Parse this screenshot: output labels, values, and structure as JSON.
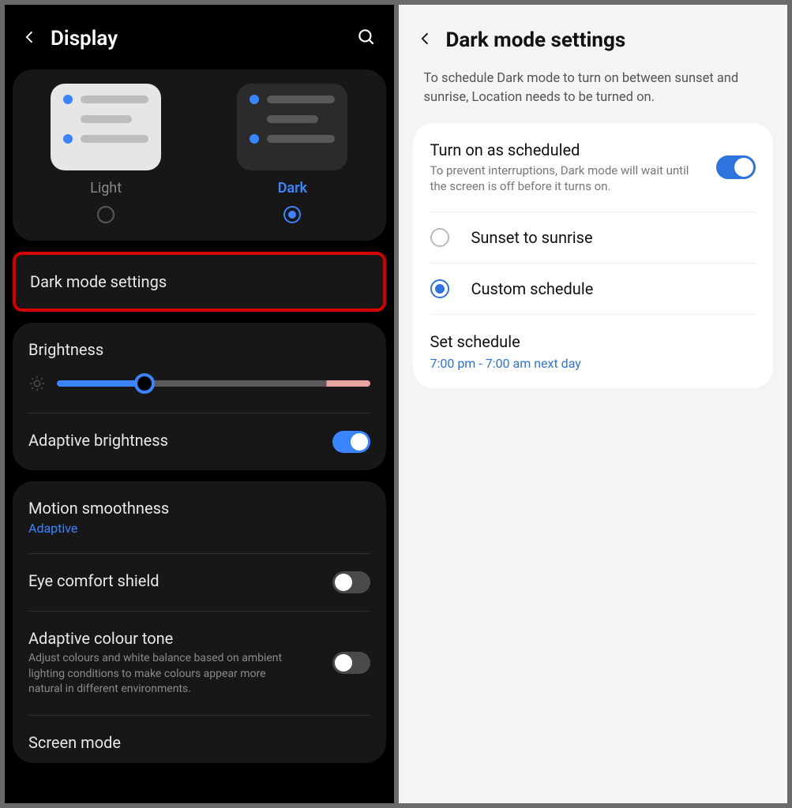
{
  "left": {
    "title": "Display",
    "theme": {
      "light_label": "Light",
      "dark_label": "Dark",
      "selected": "dark"
    },
    "dark_mode_settings_label": "Dark mode settings",
    "brightness_label": "Brightness",
    "adaptive_brightness": {
      "label": "Adaptive brightness",
      "on": true
    },
    "motion_smoothness": {
      "label": "Motion smoothness",
      "value": "Adaptive"
    },
    "eye_comfort": {
      "label": "Eye comfort shield",
      "on": false
    },
    "adaptive_colour_tone": {
      "label": "Adaptive colour tone",
      "desc": "Adjust colours and white balance based on ambient lighting conditions to make colours appear more natural in different environments.",
      "on": false
    },
    "screen_mode_label": "Screen mode"
  },
  "right": {
    "title": "Dark mode settings",
    "note": "To schedule Dark mode to turn on between sunset and sunrise, Location needs to be turned on.",
    "scheduled": {
      "label": "Turn on as scheduled",
      "desc": "To prevent interruptions, Dark mode will wait until the screen is off before it turns on.",
      "on": true
    },
    "opt_sunset": "Sunset to sunrise",
    "opt_custom": "Custom schedule",
    "set_schedule": {
      "label": "Set schedule",
      "value": "7:00 pm - 7:00 am next day"
    }
  }
}
